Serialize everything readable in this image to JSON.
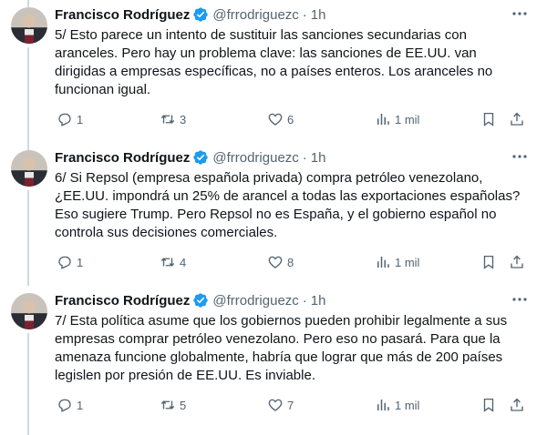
{
  "author": {
    "name": "Francisco Rodríguez",
    "handle": "@frrodriguezc",
    "separator": "·",
    "verified_color": "#1d9bf0"
  },
  "icons": {
    "more": "more-dots-icon",
    "reply": "reply-icon",
    "retweet": "retweet-icon",
    "like": "heart-icon",
    "views": "views-icon",
    "bookmark": "bookmark-icon",
    "share": "share-icon"
  },
  "tweets": [
    {
      "time": "1h",
      "text": "5/ Esto parece un intento de sustituir las sanciones secundarias con aranceles. Pero hay un problema clave: las sanciones de EE.UU. van dirigidas a empresas específicas, no a países enteros. Los aranceles no funcionan igual.",
      "replies": "1",
      "retweets": "3",
      "likes": "6",
      "views": "1 mil"
    },
    {
      "time": "1h",
      "text": "6/ Si Repsol (empresa española privada) compra petróleo venezolano, ¿EE.UU. impondrá un 25% de arancel a todas las exportaciones españolas? Eso sugiere Trump. Pero Repsol no es España, y el gobierno español no controla sus decisiones comerciales.",
      "replies": "1",
      "retweets": "4",
      "likes": "8",
      "views": "1 mil"
    },
    {
      "time": "1h",
      "text": "7/ Esta política asume que los gobiernos pueden prohibir legalmente a sus empresas comprar petróleo venezolano. Pero eso no pasará. Para que la amenaza funcione globalmente, habría que lograr que más de 200 países legislen por presión de EE.UU. Es inviable.",
      "replies": "1",
      "retweets": "5",
      "likes": "7",
      "views": "1 mil"
    }
  ]
}
